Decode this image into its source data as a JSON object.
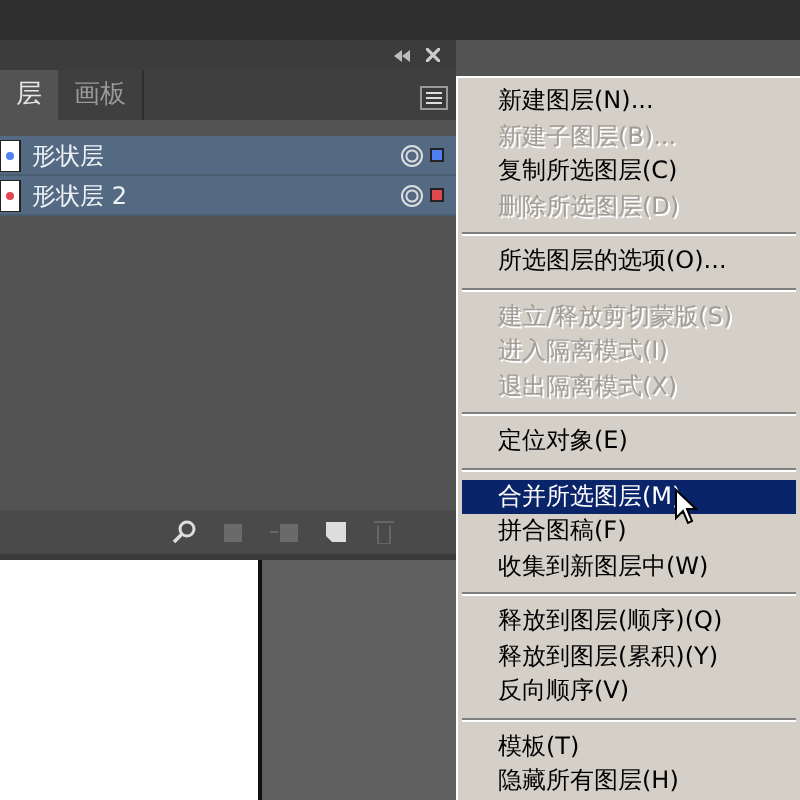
{
  "panel": {
    "tabs": [
      {
        "label": "层",
        "selected": true
      },
      {
        "label": "画板",
        "selected": false
      }
    ],
    "layers": [
      {
        "name": "形状层",
        "color": "#4f7ff0"
      },
      {
        "name": "形状层 2",
        "color": "#e0474f"
      }
    ]
  },
  "menu": {
    "sections": [
      [
        {
          "label": "新建图层(N)...",
          "disabled": false,
          "selected": false
        },
        {
          "label": "新建子图层(B)...",
          "disabled": true,
          "selected": false
        },
        {
          "label": "复制所选图层(C)",
          "disabled": false,
          "selected": false
        },
        {
          "label": "删除所选图层(D)",
          "disabled": true,
          "selected": false
        }
      ],
      [
        {
          "label": "所选图层的选项(O)...",
          "disabled": false,
          "selected": false
        }
      ],
      [
        {
          "label": "建立/释放剪切蒙版(S)",
          "disabled": true,
          "selected": false
        },
        {
          "label": "进入隔离模式(I)",
          "disabled": true,
          "selected": false
        },
        {
          "label": "退出隔离模式(X)",
          "disabled": true,
          "selected": false
        }
      ],
      [
        {
          "label": "定位对象(E)",
          "disabled": false,
          "selected": false
        }
      ],
      [
        {
          "label": "合并所选图层(M)",
          "disabled": false,
          "selected": true
        },
        {
          "label": "拼合图稿(F)",
          "disabled": false,
          "selected": false
        },
        {
          "label": "收集到新图层中(W)",
          "disabled": false,
          "selected": false
        }
      ],
      [
        {
          "label": "释放到图层(顺序)(Q)",
          "disabled": false,
          "selected": false
        },
        {
          "label": "释放到图层(累积)(Y)",
          "disabled": false,
          "selected": false
        },
        {
          "label": "反向顺序(V)",
          "disabled": false,
          "selected": false
        }
      ],
      [
        {
          "label": "模板(T)",
          "disabled": false,
          "selected": false
        },
        {
          "label": "隐藏所有图层(H)",
          "disabled": false,
          "selected": false
        }
      ]
    ]
  }
}
